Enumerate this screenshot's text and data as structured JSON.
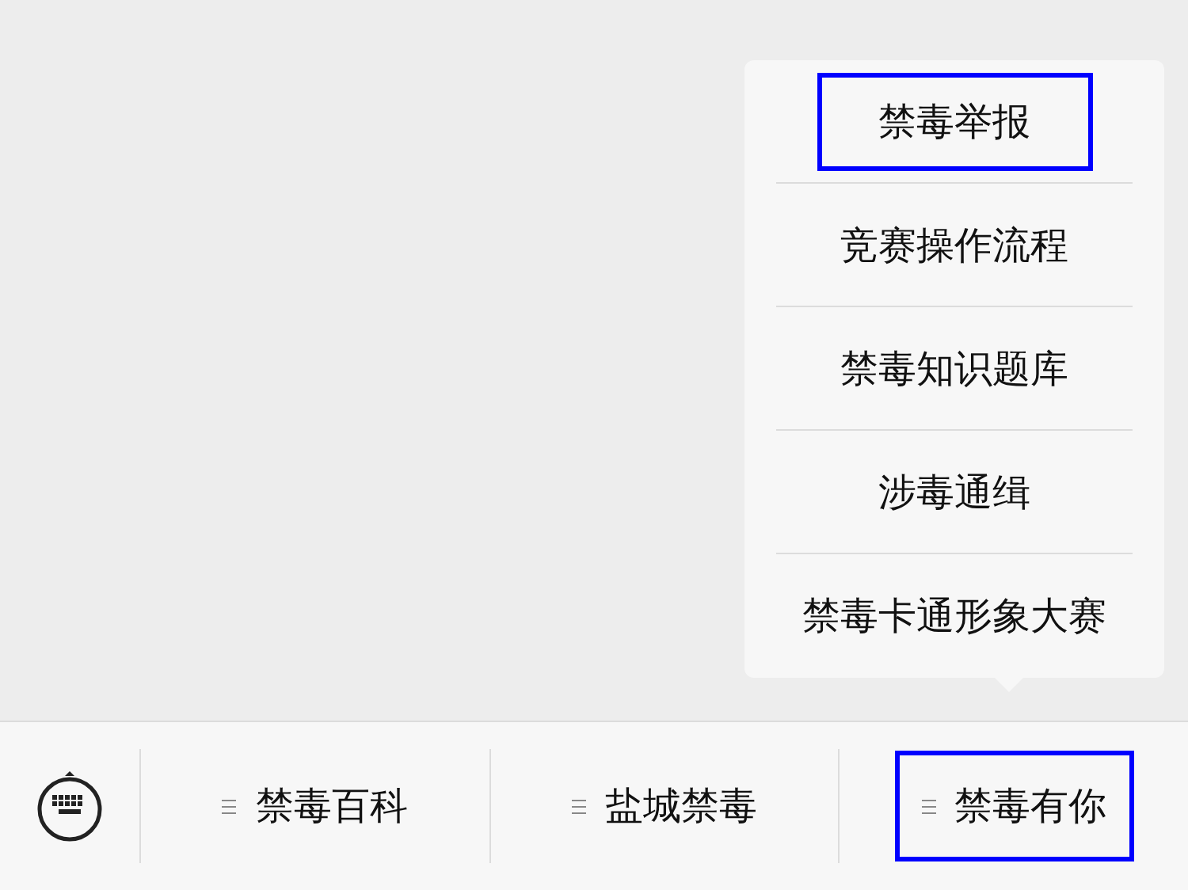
{
  "popup_menu": {
    "items": [
      {
        "label": "禁毒举报",
        "highlighted": true
      },
      {
        "label": "竞赛操作流程",
        "highlighted": false
      },
      {
        "label": "禁毒知识题库",
        "highlighted": false
      },
      {
        "label": "涉毒通缉",
        "highlighted": false
      },
      {
        "label": "禁毒卡通形象大赛",
        "highlighted": false
      }
    ]
  },
  "bottom_menu": {
    "tabs": [
      {
        "label": "禁毒百科",
        "highlighted": false
      },
      {
        "label": "盐城禁毒",
        "highlighted": false
      },
      {
        "label": "禁毒有你",
        "highlighted": true
      }
    ]
  }
}
